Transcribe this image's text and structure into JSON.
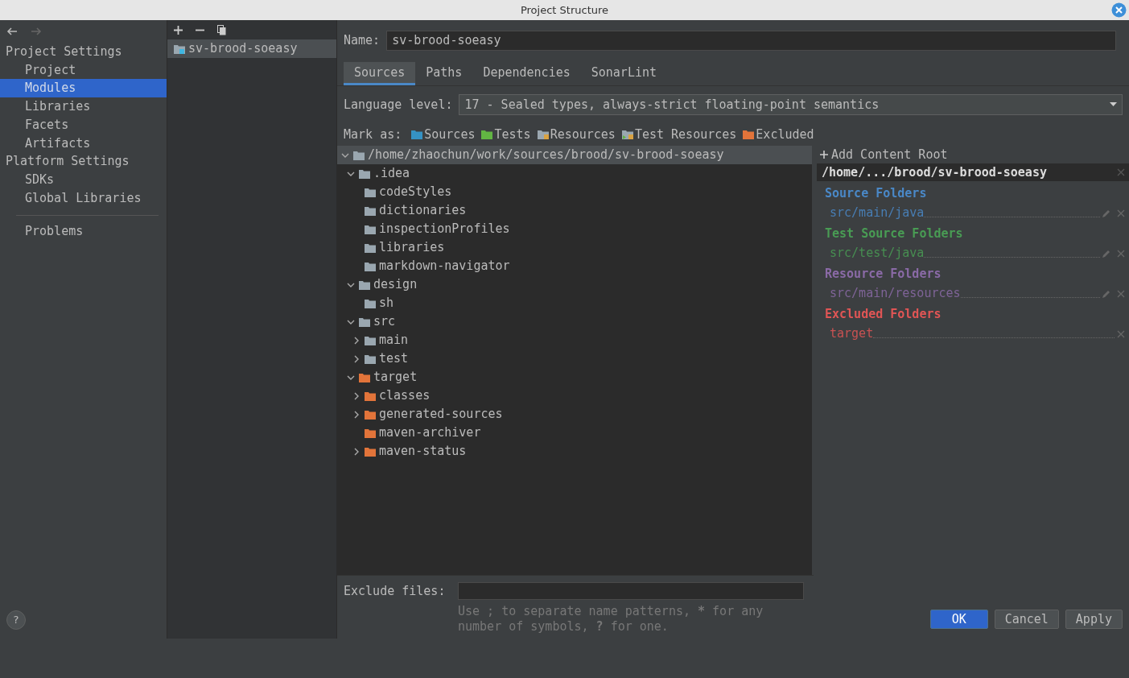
{
  "window": {
    "title": "Project Structure"
  },
  "sidebar": {
    "sections": [
      {
        "title": "Project Settings",
        "items": [
          {
            "label": "Project",
            "selected": false
          },
          {
            "label": "Modules",
            "selected": true
          },
          {
            "label": "Libraries",
            "selected": false
          },
          {
            "label": "Facets",
            "selected": false
          },
          {
            "label": "Artifacts",
            "selected": false
          }
        ]
      },
      {
        "title": "Platform Settings",
        "items": [
          {
            "label": "SDKs",
            "selected": false
          },
          {
            "label": "Global Libraries",
            "selected": false
          }
        ]
      }
    ],
    "extra_items": [
      {
        "label": "Problems",
        "selected": false
      }
    ]
  },
  "modules": {
    "items": [
      {
        "label": "sv-brood-soeasy",
        "selected": true
      }
    ]
  },
  "name_field": {
    "label": "Name:",
    "value": "sv-brood-soeasy"
  },
  "tabs": [
    {
      "label": "Sources",
      "selected": true
    },
    {
      "label": "Paths",
      "selected": false
    },
    {
      "label": "Dependencies",
      "selected": false
    },
    {
      "label": "SonarLint",
      "selected": false
    }
  ],
  "language_level": {
    "label": "Language level:",
    "value": "17 - Sealed types, always-strict floating-point semantics"
  },
  "mark_as": {
    "label": "Mark as:",
    "buttons": [
      {
        "label": "Sources",
        "kind": "sources"
      },
      {
        "label": "Tests",
        "kind": "tests"
      },
      {
        "label": "Resources",
        "kind": "resources"
      },
      {
        "label": "Test Resources",
        "kind": "test_resources"
      },
      {
        "label": "Excluded",
        "kind": "excluded"
      }
    ]
  },
  "tree": [
    {
      "label": "/home/zhaochun/work/sources/brood/sv-brood-soeasy",
      "kind": "folder",
      "expanded": true,
      "selected": true,
      "children": [
        {
          "label": ".idea",
          "kind": "folder",
          "expanded": true,
          "selected": false,
          "children": [
            {
              "label": "codeStyles",
              "kind": "folder",
              "selected": false
            },
            {
              "label": "dictionaries",
              "kind": "folder",
              "selected": false
            },
            {
              "label": "inspectionProfiles",
              "kind": "folder",
              "selected": false
            },
            {
              "label": "libraries",
              "kind": "folder",
              "selected": false
            },
            {
              "label": "markdown-navigator",
              "kind": "folder",
              "selected": false
            }
          ]
        },
        {
          "label": "design",
          "kind": "folder",
          "expanded": true,
          "selected": false,
          "children": [
            {
              "label": "sh",
              "kind": "folder",
              "selected": false
            }
          ]
        },
        {
          "label": "src",
          "kind": "folder",
          "expanded": true,
          "selected": false,
          "children": [
            {
              "label": "main",
              "kind": "folder",
              "expanded": false,
              "selected": false
            },
            {
              "label": "test",
              "kind": "folder",
              "expanded": false,
              "selected": false
            }
          ]
        },
        {
          "label": "target",
          "kind": "excluded",
          "expanded": true,
          "selected": false,
          "children": [
            {
              "label": "classes",
              "kind": "excluded",
              "expanded": false,
              "selected": false
            },
            {
              "label": "generated-sources",
              "kind": "excluded",
              "expanded": false,
              "selected": false
            },
            {
              "label": "maven-archiver",
              "kind": "excluded",
              "selected": false
            },
            {
              "label": "maven-status",
              "kind": "excluded",
              "expanded": false,
              "selected": false
            }
          ]
        }
      ]
    }
  ],
  "content_root": {
    "add_label": "Add Content Root",
    "path": "/home/.../brood/sv-brood-soeasy",
    "groups": [
      {
        "title": "Source Folders",
        "color": "#4a88c7",
        "folders": [
          {
            "path": "src/main/java",
            "editable": true
          }
        ]
      },
      {
        "title": "Test Source Folders",
        "color": "#499c54",
        "folders": [
          {
            "path": "src/test/java",
            "editable": true
          }
        ]
      },
      {
        "title": "Resource Folders",
        "color": "#8a6aa6",
        "folders": [
          {
            "path": "src/main/resources",
            "editable": true
          }
        ]
      },
      {
        "title": "Excluded Folders",
        "color": "#e05555",
        "folders": [
          {
            "path": "target",
            "editable": false
          }
        ]
      }
    ]
  },
  "exclude_files": {
    "label": "Exclude files:",
    "hint": [
      {
        "text": "Use ; to separate name patterns, ",
        "bold": false
      },
      {
        "text": "*",
        "bold": true
      },
      {
        "text": " for any number of symbols, ",
        "bold": false
      },
      {
        "text": "?",
        "bold": true
      },
      {
        "text": " for one.",
        "bold": false
      }
    ]
  },
  "help_button": {
    "label": "?"
  },
  "buttons": [
    {
      "label": "OK",
      "kind": "primary"
    },
    {
      "label": "Cancel",
      "kind": "default"
    },
    {
      "label": "Apply",
      "kind": "default"
    }
  ]
}
